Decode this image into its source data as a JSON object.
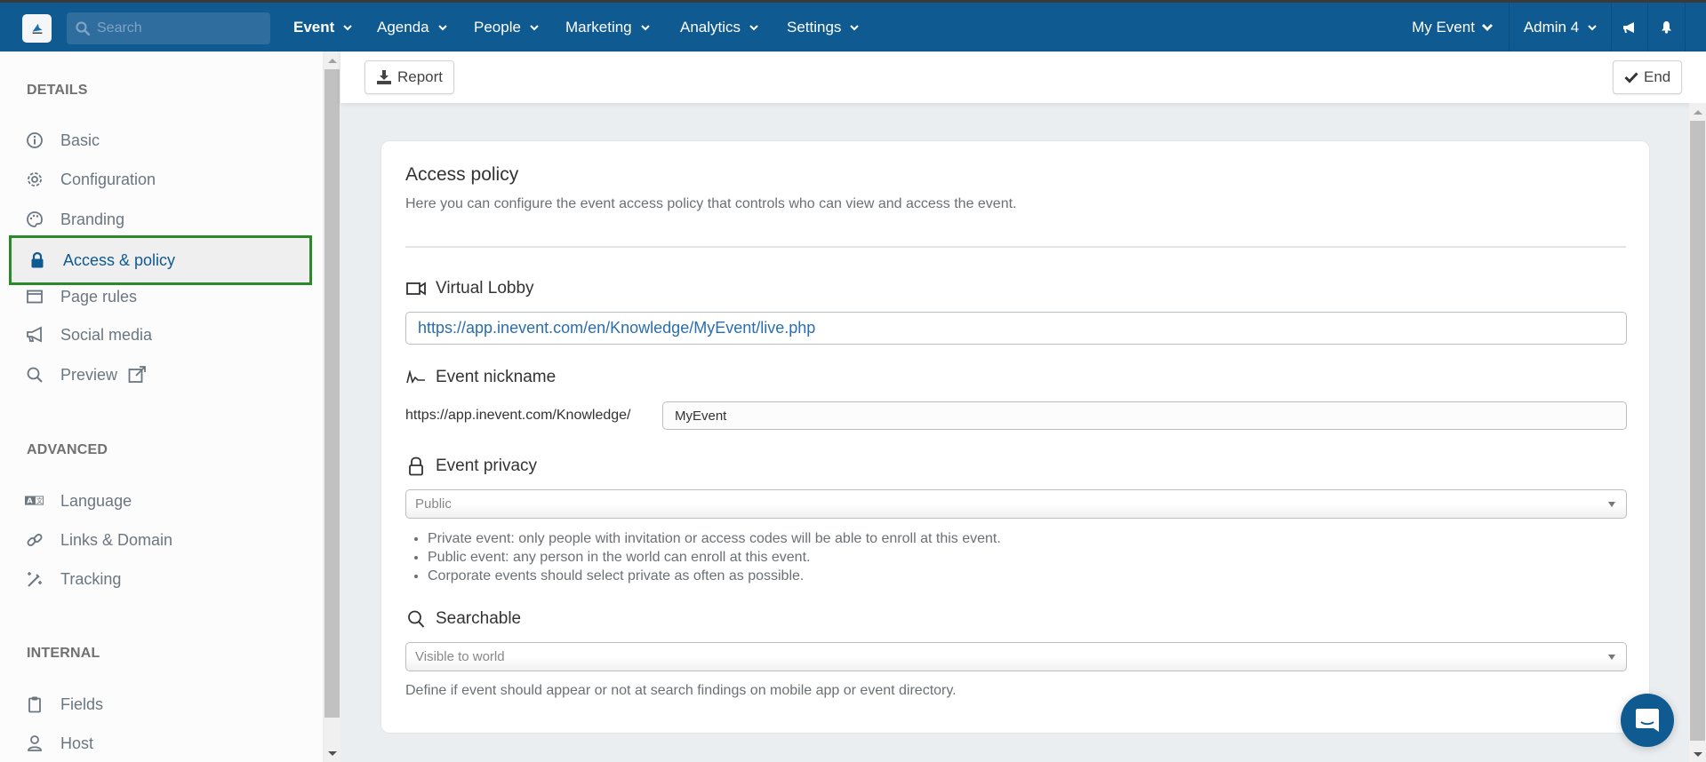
{
  "topnav": {
    "search_placeholder": "Search",
    "menu": [
      {
        "label": "Event",
        "active": true
      },
      {
        "label": "Agenda"
      },
      {
        "label": "People"
      },
      {
        "label": "Marketing"
      },
      {
        "label": "Analytics"
      },
      {
        "label": "Settings"
      }
    ],
    "event_selector": "My Event",
    "user_menu": "Admin 4",
    "icons": [
      "megaphone-icon",
      "bell-icon"
    ],
    "brand_color": "#0e5a91"
  },
  "sidebar": {
    "sections": [
      {
        "title": "DETAILS",
        "items": [
          {
            "label": "Basic",
            "icon": "info-circle-icon"
          },
          {
            "label": "Configuration",
            "icon": "gear-icon"
          },
          {
            "label": "Branding",
            "icon": "palette-icon"
          },
          {
            "label": "Access & policy",
            "icon": "lock-icon",
            "active": true
          },
          {
            "label": "Page rules",
            "icon": "window-icon"
          },
          {
            "label": "Social media",
            "icon": "megaphone-icon"
          },
          {
            "label": "Preview",
            "icon": "search-icon",
            "suffix_icon": "external-link-icon"
          }
        ]
      },
      {
        "title": "ADVANCED",
        "items": [
          {
            "label": "Language",
            "icon": "language-icon"
          },
          {
            "label": "Links & Domain",
            "icon": "link-icon"
          },
          {
            "label": "Tracking",
            "icon": "magic-wand-icon"
          }
        ]
      },
      {
        "title": "INTERNAL",
        "items": [
          {
            "label": "Fields",
            "icon": "clipboard-icon"
          },
          {
            "label": "Host",
            "icon": "user-icon"
          }
        ]
      }
    ],
    "highlight_color": "#2a8a2a"
  },
  "toolbar": {
    "report_label": "Report",
    "end_label": "End"
  },
  "content": {
    "title": "Access policy",
    "subtitle": "Here you can configure the event access policy that controls who can view and access the event.",
    "virtual_lobby": {
      "label": "Virtual Lobby",
      "value": "https://app.inevent.com/en/Knowledge/MyEvent/live.php"
    },
    "nickname": {
      "label": "Event nickname",
      "prefix": "https://app.inevent.com/Knowledge/",
      "value": "MyEvent"
    },
    "privacy": {
      "label": "Event privacy",
      "selected": "Public",
      "notes": [
        "Private event: only people with invitation or access codes will be able to enroll at this event.",
        "Public event: any person in the world can enroll at this event.",
        "Corporate events should select private as often as possible."
      ]
    },
    "searchable": {
      "label": "Searchable",
      "selected": "Visible to world",
      "help": "Define if event should appear or not at search findings on mobile app or event directory."
    }
  }
}
